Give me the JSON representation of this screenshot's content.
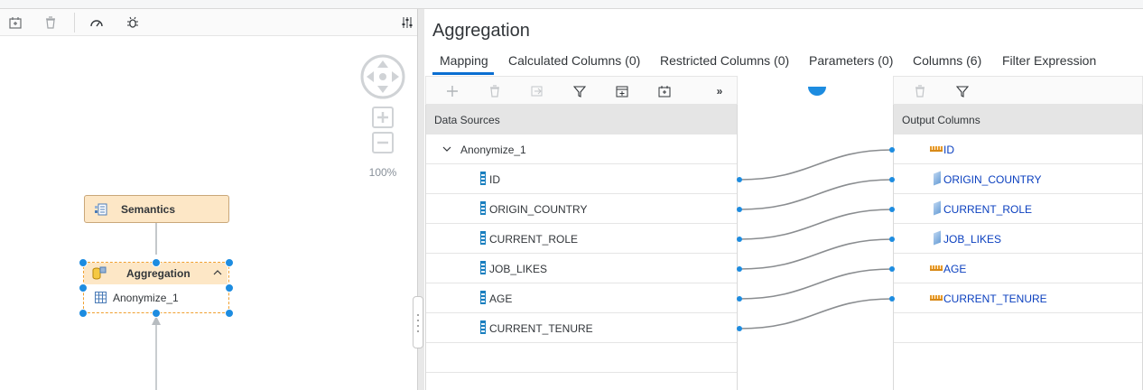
{
  "left_panel": {
    "zoom_level": "100%",
    "nodes": {
      "semantics": "Semantics",
      "aggregation": "Aggregation",
      "aggregation_source": "Anonymize_1"
    }
  },
  "right_panel": {
    "title": "Aggregation",
    "tabs": [
      {
        "label": "Mapping"
      },
      {
        "label": "Calculated Columns (0)"
      },
      {
        "label": "Restricted Columns (0)"
      },
      {
        "label": "Parameters (0)"
      },
      {
        "label": "Columns (6)"
      },
      {
        "label": "Filter Expression"
      }
    ],
    "data_sources": {
      "header": "Data Sources",
      "group": "Anonymize_1",
      "columns": [
        "ID",
        "ORIGIN_COUNTRY",
        "CURRENT_ROLE",
        "JOB_LIKES",
        "AGE",
        "CURRENT_TENURE"
      ]
    },
    "output_columns": {
      "header": "Output Columns",
      "columns": [
        {
          "name": "ID",
          "kind": "measure"
        },
        {
          "name": "ORIGIN_COUNTRY",
          "kind": "attribute"
        },
        {
          "name": "CURRENT_ROLE",
          "kind": "attribute"
        },
        {
          "name": "JOB_LIKES",
          "kind": "attribute"
        },
        {
          "name": "AGE",
          "kind": "measure"
        },
        {
          "name": "CURRENT_TENURE",
          "kind": "measure"
        }
      ]
    }
  },
  "colors": {
    "accent": "#0a6ed1",
    "handle": "#1d8ce0",
    "node_fill": "#fde7c6",
    "link_text": "#0a3fbf"
  }
}
